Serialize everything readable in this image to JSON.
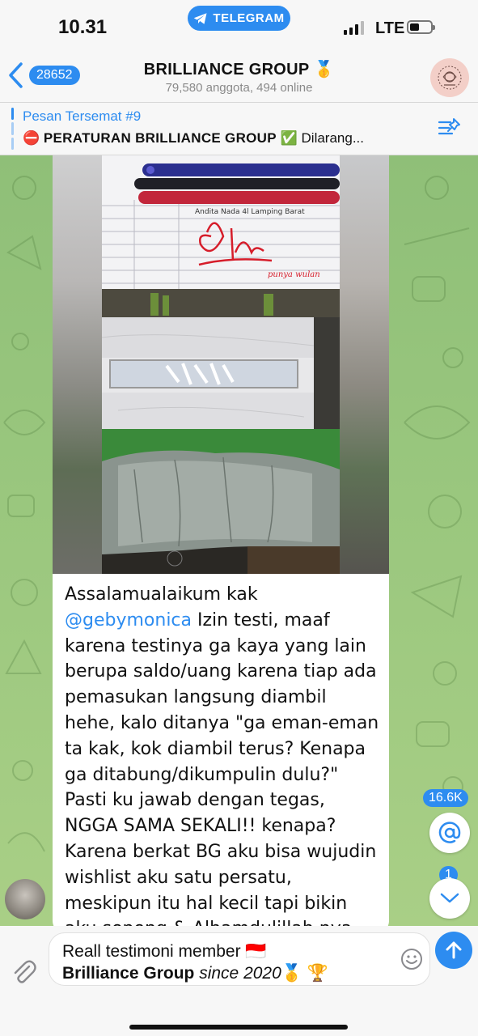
{
  "status_bar": {
    "time": "10.31",
    "app_pill": "TELEGRAM",
    "network": "LTE"
  },
  "header": {
    "back_count": "28652",
    "title": "BRILLIANCE GROUP 🥇",
    "subtitle": "79,580 anggota, 494 online"
  },
  "pinned": {
    "label": "Pesan Tersemat #9",
    "text_icon": "⛔",
    "text_bold": "PERATURAN BRILLIANCE GROUP",
    "text_check": "✅",
    "text_rest": " Dilarang..."
  },
  "message": {
    "greeting": "Assalamualaikum kak ",
    "mention": "@gebymonica",
    "body": "Izin testi, maaf karena testinya ga kaya yang lain berupa saldo/uang karena tiap ada pemasukan langsung diambil hehe, kalo ditanya \"ga eman-eman ta kak, kok diambil terus? Kenapa ga ditabung/dikumpulin dulu?\" Pasti ku jawab dengan tegas, NGGA SAMA SEKALI!! kenapa? Karena berkat BG aku bisa wujudin wishlist aku satu persatu, meskipun itu hal kecil tapi bikin aku seneng & Alhamdulillah nya tahun kemarin bisa kebeli lemari lalu tahun ini bisa bantu"
  },
  "photo": {
    "handwriting": "punya wulan"
  },
  "fabs": {
    "mention_count": "16.6K",
    "unread_count": "1"
  },
  "composer": {
    "line1": "Reall testimoni member 🇮🇩",
    "line2_bold": "Brilliance Group",
    "line2_italic": " since 2020",
    "line2_emoji": "🥇 🏆"
  },
  "icons": [
    "telegram-icon",
    "back-chevron-icon",
    "group-avatar",
    "pinned-list-icon",
    "attach-icon",
    "emoji-icon",
    "send-icon",
    "mention-icon",
    "chevron-down-icon"
  ]
}
